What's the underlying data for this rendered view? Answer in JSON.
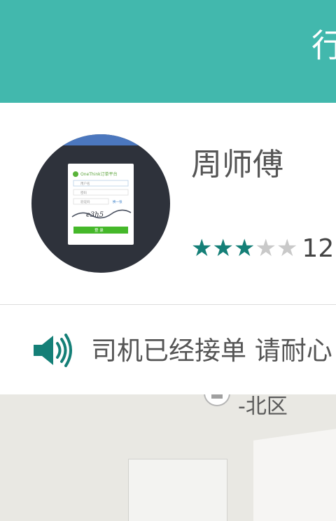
{
  "header": {
    "title": "行"
  },
  "driver": {
    "name": "周师傅",
    "rating_stars": 3,
    "rating_max": 5,
    "rating_count": "12"
  },
  "avatar_screen": {
    "brand": "OneThink订单平台",
    "field_user": "用户名",
    "field_password": "密码",
    "field_captcha": "验证码",
    "refresh": "换一张",
    "captcha": "e3h5",
    "submit": "登 录"
  },
  "status": {
    "message": "司机已经接单 请耐心"
  },
  "map": {
    "label": "-北区"
  },
  "colors": {
    "accent": "#42b8ad",
    "star_on": "#147f77",
    "star_off": "#c9c9c9"
  },
  "icons": {
    "speaker": "speaker-icon",
    "star": "star-icon",
    "poi": "map-poi-icon"
  }
}
